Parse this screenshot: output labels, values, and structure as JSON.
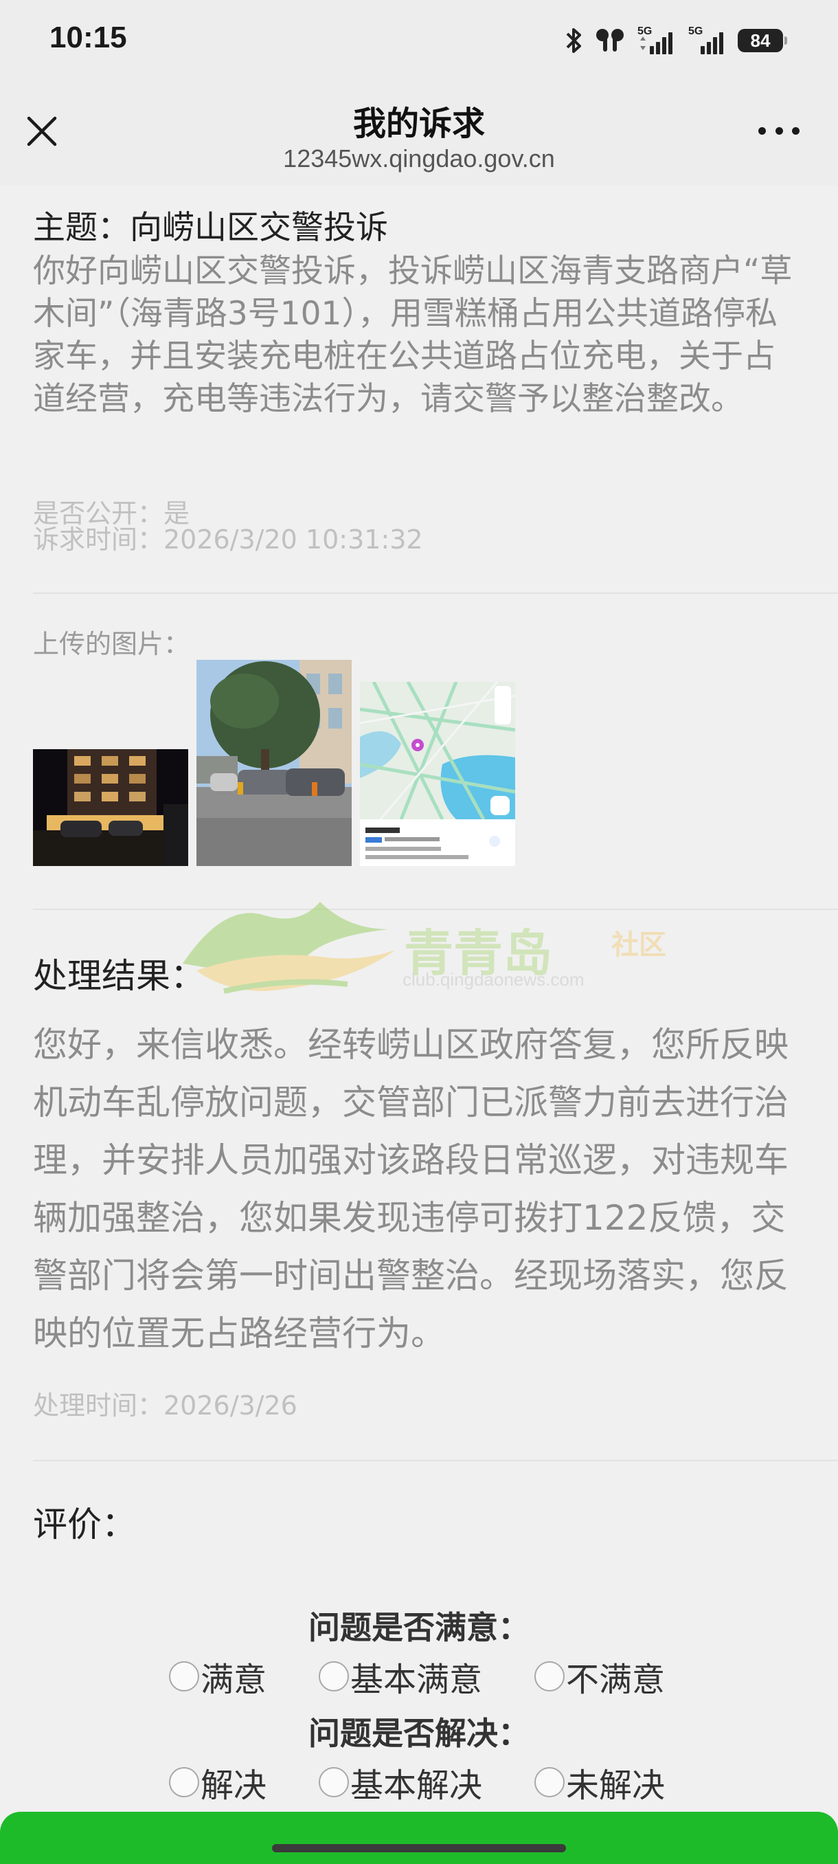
{
  "status_bar": {
    "time": "10:15",
    "battery": "84",
    "network_1": "5G",
    "network_2": "5G",
    "icons": [
      "bluetooth-icon",
      "earbuds-icon",
      "signal-icon",
      "signal-icon",
      "battery-icon"
    ]
  },
  "nav": {
    "title": "我的诉求",
    "url": "12345wx.qingdao.gov.cn",
    "close_icon": "close-icon",
    "more_icon": "more-icon"
  },
  "complaint": {
    "subject": "主题：向崂山区交警投诉",
    "body": "你好向崂山区交警投诉，投诉崂山区海青支路商户“草木间”（海青路3号101），用雪糕桶占用公共道路停私家车，并且安装充电桩在公共道路占位充电，关于占道经营，充电等违法行为，请交警予以整治整改。",
    "public_label": "是否公开：是",
    "time_label": "诉求时间：2026/3/20 10:31:32"
  },
  "images": {
    "label": "上传的图片："
  },
  "watermark": {
    "brand": "青青岛",
    "sub": "社区",
    "url": "club.qingdaonews.com"
  },
  "result": {
    "title": "处理结果：",
    "body": "您好，来信收悉。经转崂山区政府答复，您所反映机动车乱停放问题，交管部门已派警力前去进行治理，并安排人员加强对该路段日常巡逻，对违规车辆加强整治，您如果发现违停可拨打122反馈，交警部门将会第一时间出警整治。经现场落实，您反映的位置无占路经营行为。",
    "time_label": "处理时间：2026/3/26"
  },
  "evaluation": {
    "title": "评价：",
    "q1": "问题是否满意：",
    "q1_options": [
      "满意",
      "基本满意",
      "不满意"
    ],
    "q2": "问题是否解决：",
    "q2_options": [
      "解决",
      "基本解决",
      "未解决"
    ]
  },
  "colors": {
    "submit_bar": "#1dbb2a",
    "background": "#f0f0f0"
  }
}
